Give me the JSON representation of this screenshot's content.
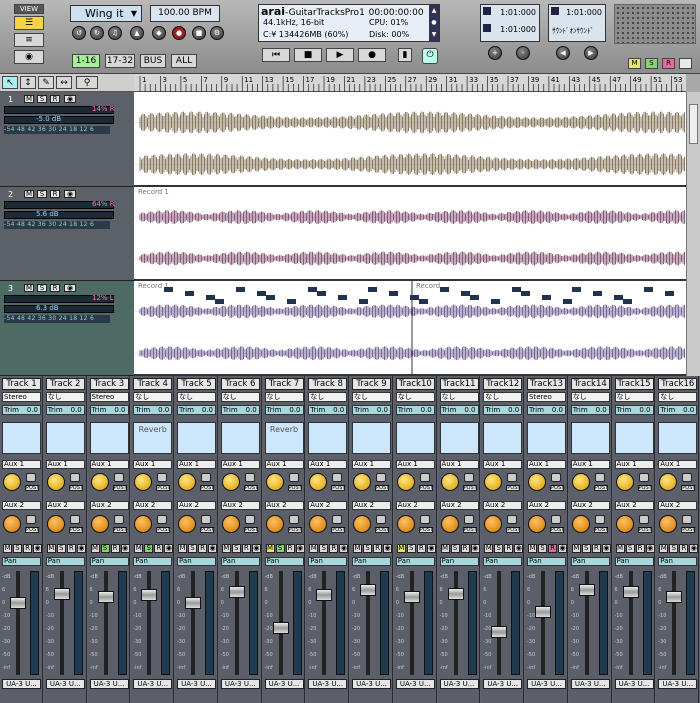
{
  "toolbar": {
    "view_label": "VIEW",
    "preset": "Wing it",
    "tempo": "100.00 BPM",
    "bank_buttons": [
      "1-16",
      "17-32",
      "BUS",
      "ALL"
    ],
    "title_name": "arai",
    "title_app": "GuitarTracksPro1",
    "time": "00:00:00:00",
    "format": "44.1kHz, 16-bit",
    "cpu_label": "CPU: 01%",
    "disk_free": "C:¥ 134426MB (60%)",
    "disk_label": "Disk: 00%",
    "marker1": "1:01:000",
    "marker2": "1:01:000",
    "marker3": "1:01:000",
    "marker4": "1:01:000",
    "marker_name": "ｻｳﾝﾄﾞｵﾝｻｳﾝﾄﾞ",
    "msr": [
      "M",
      "S",
      "R"
    ]
  },
  "ruler": [
    "1",
    "3",
    "5",
    "7",
    "9",
    "11",
    "13",
    "15",
    "17",
    "19",
    "21",
    "23",
    "25",
    "27",
    "29",
    "31",
    "33",
    "35",
    "37",
    "39",
    "41",
    "43",
    "45",
    "47",
    "49",
    "51",
    "53"
  ],
  "tracks": [
    {
      "num": "1",
      "pan": "14% R",
      "vol": "-5.0 dB",
      "clip": "",
      "color": "#8a7a60"
    },
    {
      "num": "2",
      "pan": "64% R",
      "vol": "5.6 dB",
      "clip": "Record 1",
      "color": "#8a5a7a"
    },
    {
      "num": "3",
      "pan": "12% L",
      "vol": "6.3 dB",
      "clip": "Record 1",
      "clip2": "Record",
      "color": "#7a6a9a"
    }
  ],
  "meter_strip": "-54 48 42 36 30 24 18 12 6",
  "strips": [
    {
      "name": "Track 1",
      "input": "Stereo",
      "trim": "0.0",
      "fx": "",
      "out": "UA-3 U...",
      "fader": 0.72,
      "hl": ""
    },
    {
      "name": "Track 2",
      "input": "なし",
      "trim": "0.0",
      "fx": "",
      "out": "UA-3 U...",
      "fader": 0.82,
      "hl": ""
    },
    {
      "name": "Track 3",
      "input": "Stereo",
      "trim": "0.0",
      "fx": "",
      "out": "UA-3 U...",
      "fader": 0.78,
      "hl": "S"
    },
    {
      "name": "Track 4",
      "input": "なし",
      "trim": "0.0",
      "fx": "Reverb",
      "out": "UA-3 U...",
      "fader": 0.8,
      "hl": "S"
    },
    {
      "name": "Track 5",
      "input": "なし",
      "trim": "0.0",
      "fx": "",
      "out": "UA-3 U...",
      "fader": 0.72,
      "hl": ""
    },
    {
      "name": "Track 6",
      "input": "なし",
      "trim": "0.0",
      "fx": "",
      "out": "UA-3 U...",
      "fader": 0.84,
      "hl": ""
    },
    {
      "name": "Track 7",
      "input": "なし",
      "trim": "0.0",
      "fx": "Reverb",
      "out": "UA-3 U...",
      "fader": 0.45,
      "hl": "MS"
    },
    {
      "name": "Track 8",
      "input": "なし",
      "trim": "0.0",
      "fx": "",
      "out": "UA-3 U...",
      "fader": 0.8,
      "hl": ""
    },
    {
      "name": "Track 9",
      "input": "なし",
      "trim": "0.0",
      "fx": "",
      "out": "UA-3 U...",
      "fader": 0.86,
      "hl": ""
    },
    {
      "name": "Track10",
      "input": "なし",
      "trim": "0.0",
      "fx": "",
      "out": "UA-3 U...",
      "fader": 0.78,
      "hl": "M"
    },
    {
      "name": "Track11",
      "input": "なし",
      "trim": "0.0",
      "fx": "",
      "out": "UA-3 U...",
      "fader": 0.82,
      "hl": ""
    },
    {
      "name": "Track12",
      "input": "なし",
      "trim": "0.0",
      "fx": "",
      "out": "UA-3 U...",
      "fader": 0.4,
      "hl": ""
    },
    {
      "name": "Track13",
      "input": "Stereo",
      "trim": "0.0",
      "fx": "",
      "out": "UA-3 U...",
      "fader": 0.62,
      "hl": "R"
    },
    {
      "name": "Track14",
      "input": "なし",
      "trim": "0.0",
      "fx": "",
      "out": "UA-3 U...",
      "fader": 0.86,
      "hl": ""
    },
    {
      "name": "Track15",
      "input": "なし",
      "trim": "0.0",
      "fx": "",
      "out": "UA-3 U...",
      "fader": 0.84,
      "hl": ""
    },
    {
      "name": "Track16",
      "input": "なし",
      "trim": "0.0",
      "fx": "",
      "out": "UA-3 U...",
      "fader": 0.78,
      "hl": ""
    }
  ],
  "strip_labels": {
    "trim": "Trim",
    "aux1": "Aux 1",
    "aux2": "Aux 2",
    "post": "POST",
    "pan": "Pan",
    "m": "M",
    "s": "S",
    "r": "R"
  },
  "scale_labels": [
    "-dB",
    "6",
    "0",
    "-10",
    "-20",
    "-30",
    "-50",
    "-inf"
  ]
}
